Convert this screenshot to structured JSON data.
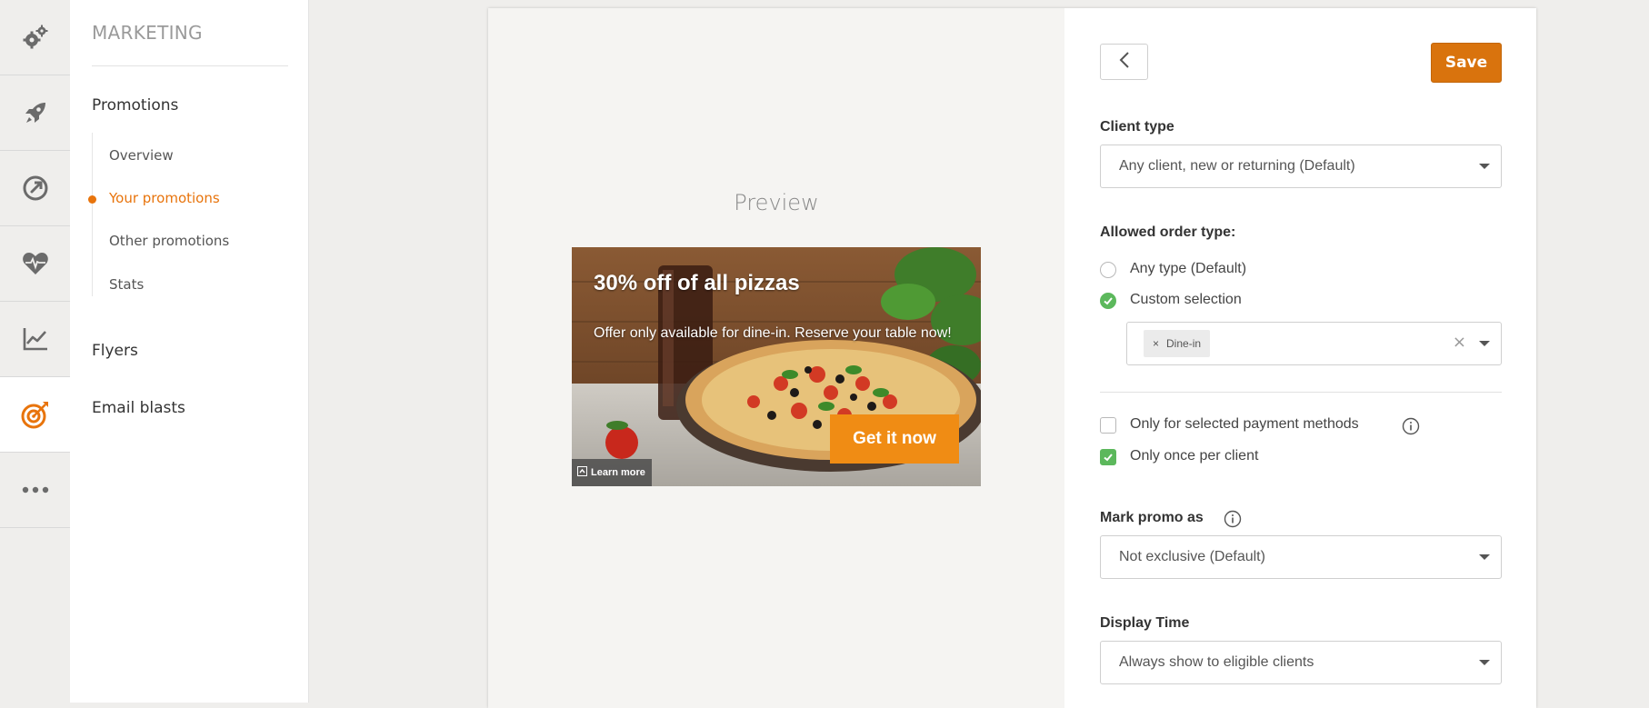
{
  "rail": {
    "items": [
      {
        "icon": "gears-icon"
      },
      {
        "icon": "rocket-icon"
      },
      {
        "icon": "speedometer-icon"
      },
      {
        "icon": "heartbeat-icon"
      },
      {
        "icon": "line-chart-icon"
      },
      {
        "icon": "target-icon",
        "active": true
      },
      {
        "icon": "more-dots-icon"
      }
    ],
    "active_color": "#e8740c"
  },
  "subnav": {
    "title": "MARKETING",
    "sections": [
      {
        "label": "Promotions"
      },
      {
        "label": "Flyers"
      },
      {
        "label": "Email blasts"
      }
    ],
    "promotions_items": [
      {
        "label": "Overview"
      },
      {
        "label": "Your promotions",
        "active": true
      },
      {
        "label": "Other promotions"
      },
      {
        "label": "Stats"
      }
    ]
  },
  "preview": {
    "title": "Preview",
    "banner": {
      "headline": "30% off of all pizzas",
      "description": "Offer only available for dine-in. Reserve your table now!",
      "cta": "Get it now",
      "learn_more": "Learn more",
      "cta_color": "#f08c14"
    }
  },
  "form": {
    "save_label": "Save",
    "client_type": {
      "label": "Client type",
      "value": "Any client, new or returning (Default)"
    },
    "order_type": {
      "label": "Allowed order type:",
      "options": [
        {
          "label": "Any type (Default)",
          "checked": false
        },
        {
          "label": "Custom selection",
          "checked": true
        }
      ],
      "selected_tags": [
        "Dine-in"
      ]
    },
    "checkboxes": [
      {
        "label": "Only for selected payment methods",
        "checked": false
      },
      {
        "label": "Only once per client",
        "checked": true
      }
    ],
    "mark_promo": {
      "label": "Mark promo as",
      "value": "Not exclusive (Default)"
    },
    "display_time": {
      "label": "Display Time",
      "value": "Always show to eligible clients"
    },
    "accent_color": "#d9730d",
    "check_color": "#5cb85c"
  }
}
